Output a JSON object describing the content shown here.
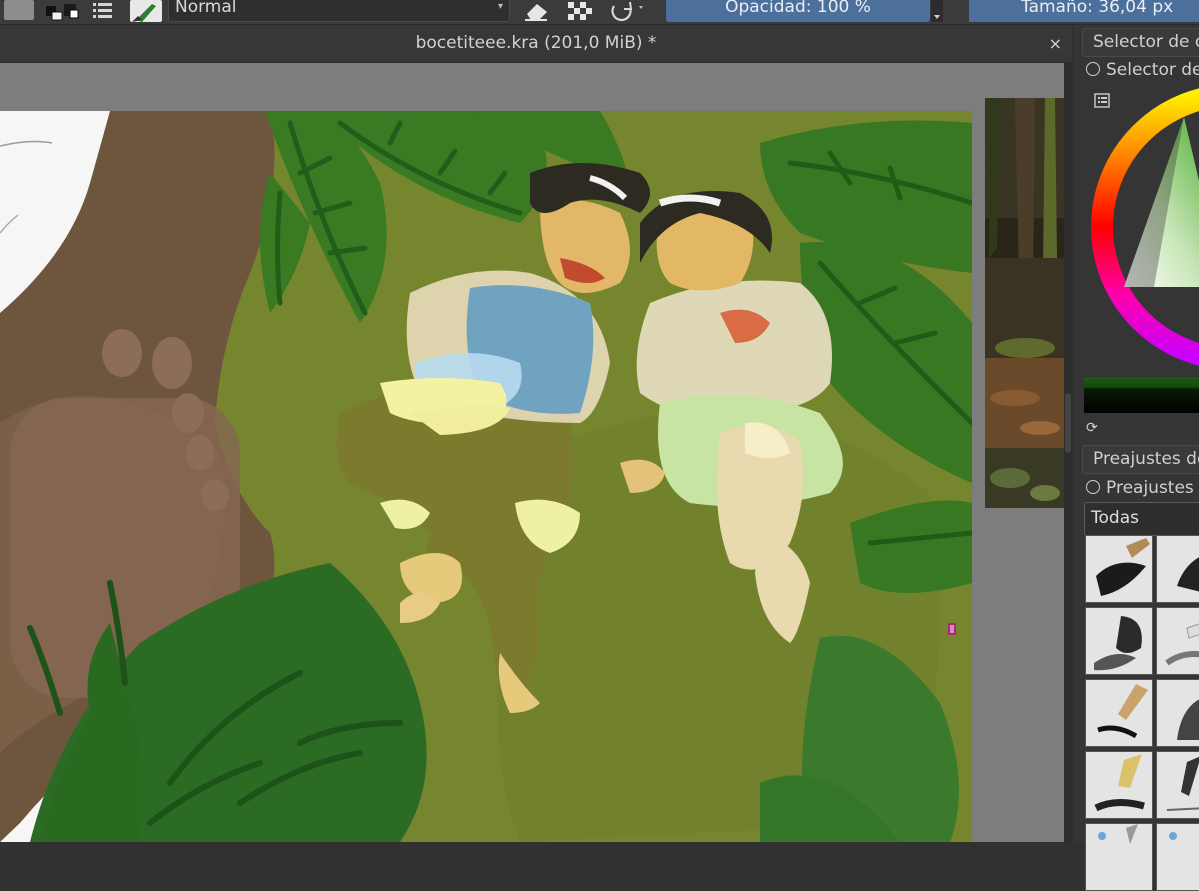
{
  "toolbar": {
    "blend_mode": "Normal",
    "opacity_label": "Opacidad: 100 %",
    "size_label": "Tamaño: 36,04 px"
  },
  "document": {
    "tab_title": "bocetiteee.kra (201,0 MiB) *",
    "close_glyph": "×"
  },
  "docker": {
    "color_selector_title": "Selector de c",
    "color_selector_subtitle": "Selector de",
    "presets_title": "Preajustes de",
    "presets_subtitle": "Preajustes",
    "tag_filter": "Todas"
  },
  "icons": {
    "swatches": "color-swatch-icon",
    "list": "list-icon",
    "brush": "brush-preset-icon",
    "eraser": "eraser-icon",
    "alpha": "preserve-alpha-icon",
    "reload": "reload-preset-icon",
    "close": "close-icon",
    "lock": "lock-icon",
    "cycle": "cycle-icon"
  },
  "colors": {
    "accent": "#4c6f9c",
    "canvas_bg": "#7d7d7d",
    "grass": "#76862f",
    "leaf_dark": "#2c6b24",
    "trunk": "#6e563e"
  }
}
